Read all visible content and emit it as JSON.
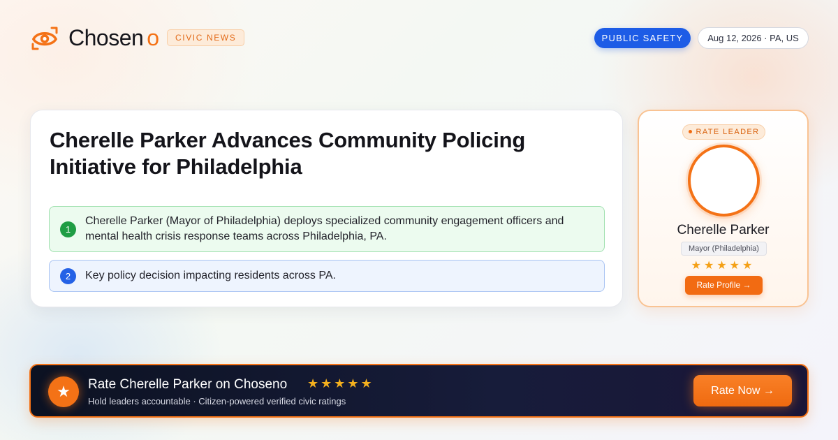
{
  "brand": {
    "name": "Chosen",
    "name_suffix": "o",
    "accent_color": "#f47216",
    "tag": "CIVIC NEWS"
  },
  "header": {
    "category": "PUBLIC SAFETY",
    "date_location": "Aug 12, 2026 · PA, US"
  },
  "article": {
    "title": "Cherelle Parker Advances Community Policing Initiative for Philadelphia",
    "points": [
      {
        "number": "1",
        "text": "Cherelle Parker (Mayor of Philadelphia) deploys specialized community engagement officers and mental health crisis response teams across Philadelphia, PA.",
        "color": "#1f9d44"
      },
      {
        "number": "2",
        "text": "Key policy decision impacting residents across PA.",
        "color": "#2562e6"
      }
    ]
  },
  "leader": {
    "badge": "RATE LEADER",
    "name": "Cherelle Parker",
    "role": "Mayor (Philadelphia)",
    "stars": "★★★★★",
    "button": "Rate Profile →"
  },
  "cta": {
    "title": "Rate Cherelle Parker on Choseno",
    "stars": "★★★★★",
    "subtitle": "Hold leaders accountable · Citizen-powered verified civic ratings",
    "button": "Rate Now →",
    "icon": "star-icon"
  }
}
